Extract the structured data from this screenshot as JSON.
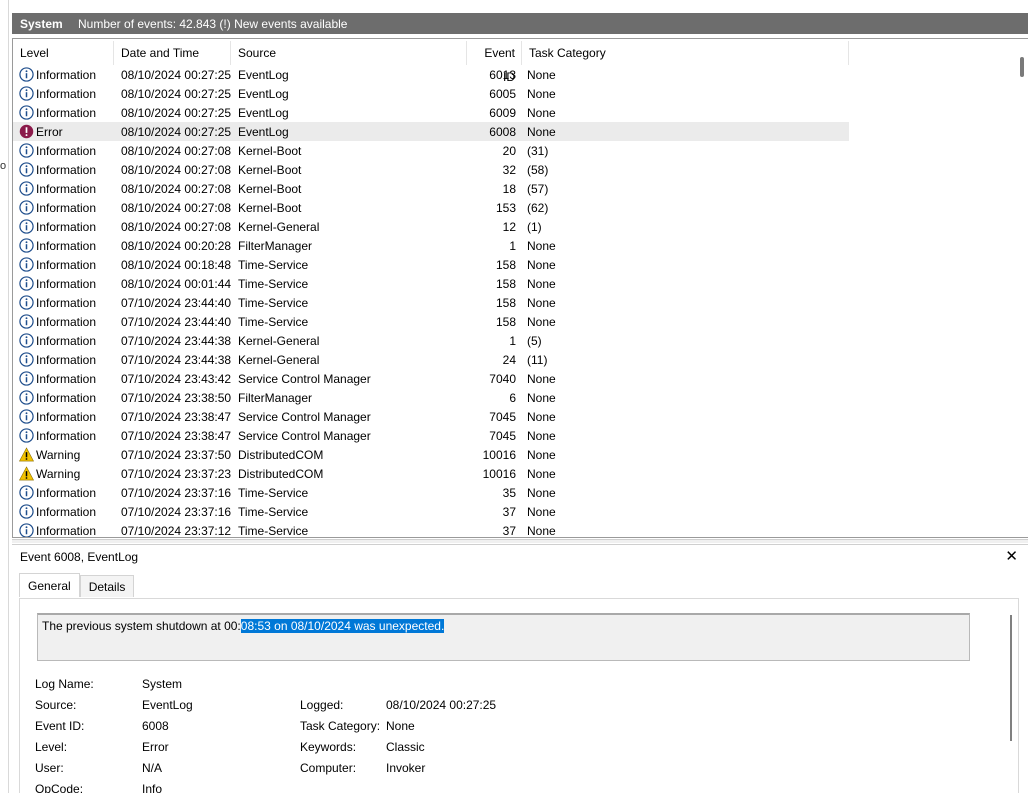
{
  "header": {
    "log_name": "System",
    "event_count": "Number of events: 42.843 (!) New events available"
  },
  "columns": {
    "level": "Level",
    "date": "Date and Time",
    "source": "Source",
    "event_id": "Event ID",
    "task": "Task Category"
  },
  "events": [
    {
      "level": "Information",
      "icon": "info-icon",
      "date": "08/10/2024 00:27:25",
      "source": "EventLog",
      "id": "6013",
      "task": "None"
    },
    {
      "level": "Information",
      "icon": "info-icon",
      "date": "08/10/2024 00:27:25",
      "source": "EventLog",
      "id": "6005",
      "task": "None"
    },
    {
      "level": "Information",
      "icon": "info-icon",
      "date": "08/10/2024 00:27:25",
      "source": "EventLog",
      "id": "6009",
      "task": "None"
    },
    {
      "level": "Error",
      "icon": "error-icon",
      "date": "08/10/2024 00:27:25",
      "source": "EventLog",
      "id": "6008",
      "task": "None",
      "selected": true
    },
    {
      "level": "Information",
      "icon": "info-icon",
      "date": "08/10/2024 00:27:08",
      "source": "Kernel-Boot",
      "id": "20",
      "task": "(31)"
    },
    {
      "level": "Information",
      "icon": "info-icon",
      "date": "08/10/2024 00:27:08",
      "source": "Kernel-Boot",
      "id": "32",
      "task": "(58)"
    },
    {
      "level": "Information",
      "icon": "info-icon",
      "date": "08/10/2024 00:27:08",
      "source": "Kernel-Boot",
      "id": "18",
      "task": "(57)"
    },
    {
      "level": "Information",
      "icon": "info-icon",
      "date": "08/10/2024 00:27:08",
      "source": "Kernel-Boot",
      "id": "153",
      "task": "(62)"
    },
    {
      "level": "Information",
      "icon": "info-icon",
      "date": "08/10/2024 00:27:08",
      "source": "Kernel-General",
      "id": "12",
      "task": "(1)"
    },
    {
      "level": "Information",
      "icon": "info-icon",
      "date": "08/10/2024 00:20:28",
      "source": "FilterManager",
      "id": "1",
      "task": "None"
    },
    {
      "level": "Information",
      "icon": "info-icon",
      "date": "08/10/2024 00:18:48",
      "source": "Time-Service",
      "id": "158",
      "task": "None"
    },
    {
      "level": "Information",
      "icon": "info-icon",
      "date": "08/10/2024 00:01:44",
      "source": "Time-Service",
      "id": "158",
      "task": "None"
    },
    {
      "level": "Information",
      "icon": "info-icon",
      "date": "07/10/2024 23:44:40",
      "source": "Time-Service",
      "id": "158",
      "task": "None"
    },
    {
      "level": "Information",
      "icon": "info-icon",
      "date": "07/10/2024 23:44:40",
      "source": "Time-Service",
      "id": "158",
      "task": "None"
    },
    {
      "level": "Information",
      "icon": "info-icon",
      "date": "07/10/2024 23:44:38",
      "source": "Kernel-General",
      "id": "1",
      "task": "(5)"
    },
    {
      "level": "Information",
      "icon": "info-icon",
      "date": "07/10/2024 23:44:38",
      "source": "Kernel-General",
      "id": "24",
      "task": "(11)"
    },
    {
      "level": "Information",
      "icon": "info-icon",
      "date": "07/10/2024 23:43:42",
      "source": "Service Control Manager",
      "id": "7040",
      "task": "None"
    },
    {
      "level": "Information",
      "icon": "info-icon",
      "date": "07/10/2024 23:38:50",
      "source": "FilterManager",
      "id": "6",
      "task": "None"
    },
    {
      "level": "Information",
      "icon": "info-icon",
      "date": "07/10/2024 23:38:47",
      "source": "Service Control Manager",
      "id": "7045",
      "task": "None"
    },
    {
      "level": "Information",
      "icon": "info-icon",
      "date": "07/10/2024 23:38:47",
      "source": "Service Control Manager",
      "id": "7045",
      "task": "None"
    },
    {
      "level": "Warning",
      "icon": "warning-icon",
      "date": "07/10/2024 23:37:50",
      "source": "DistributedCOM",
      "id": "10016",
      "task": "None"
    },
    {
      "level": "Warning",
      "icon": "warning-icon",
      "date": "07/10/2024 23:37:23",
      "source": "DistributedCOM",
      "id": "10016",
      "task": "None"
    },
    {
      "level": "Information",
      "icon": "info-icon",
      "date": "07/10/2024 23:37:16",
      "source": "Time-Service",
      "id": "35",
      "task": "None"
    },
    {
      "level": "Information",
      "icon": "info-icon",
      "date": "07/10/2024 23:37:16",
      "source": "Time-Service",
      "id": "37",
      "task": "None"
    },
    {
      "level": "Information",
      "icon": "info-icon",
      "date": "07/10/2024 23:37:12",
      "source": "Time-Service",
      "id": "37",
      "task": "None"
    }
  ],
  "detail": {
    "title": "Event 6008, EventLog",
    "close_label": "✕",
    "tabs": [
      "General",
      "Details"
    ],
    "description_prefix": "The previous system shutdown at 00:",
    "description_selected": "08:53 on 08/10/2024 was unexpected.",
    "labels": {
      "log_name": "Log Name:",
      "source": "Source:",
      "event_id": "Event ID:",
      "level": "Level:",
      "user": "User:",
      "opcode": "OpCode:",
      "logged": "Logged:",
      "task_category": "Task Category:",
      "keywords": "Keywords:",
      "computer": "Computer:"
    },
    "values": {
      "log_name": "System",
      "source": "EventLog",
      "event_id": "6008",
      "level": "Error",
      "user": "N/A",
      "opcode": "Info",
      "logged": "08/10/2024 00:27:25",
      "task_category": "None",
      "keywords": "Classic",
      "computer": "Invoker"
    }
  },
  "colors": {
    "header_bg": "#6d6d6d",
    "selection": "#0078d7",
    "info_icon": "#1f4e8c",
    "error_icon": "#8b1a4a",
    "warning_icon": "#f2c200"
  }
}
